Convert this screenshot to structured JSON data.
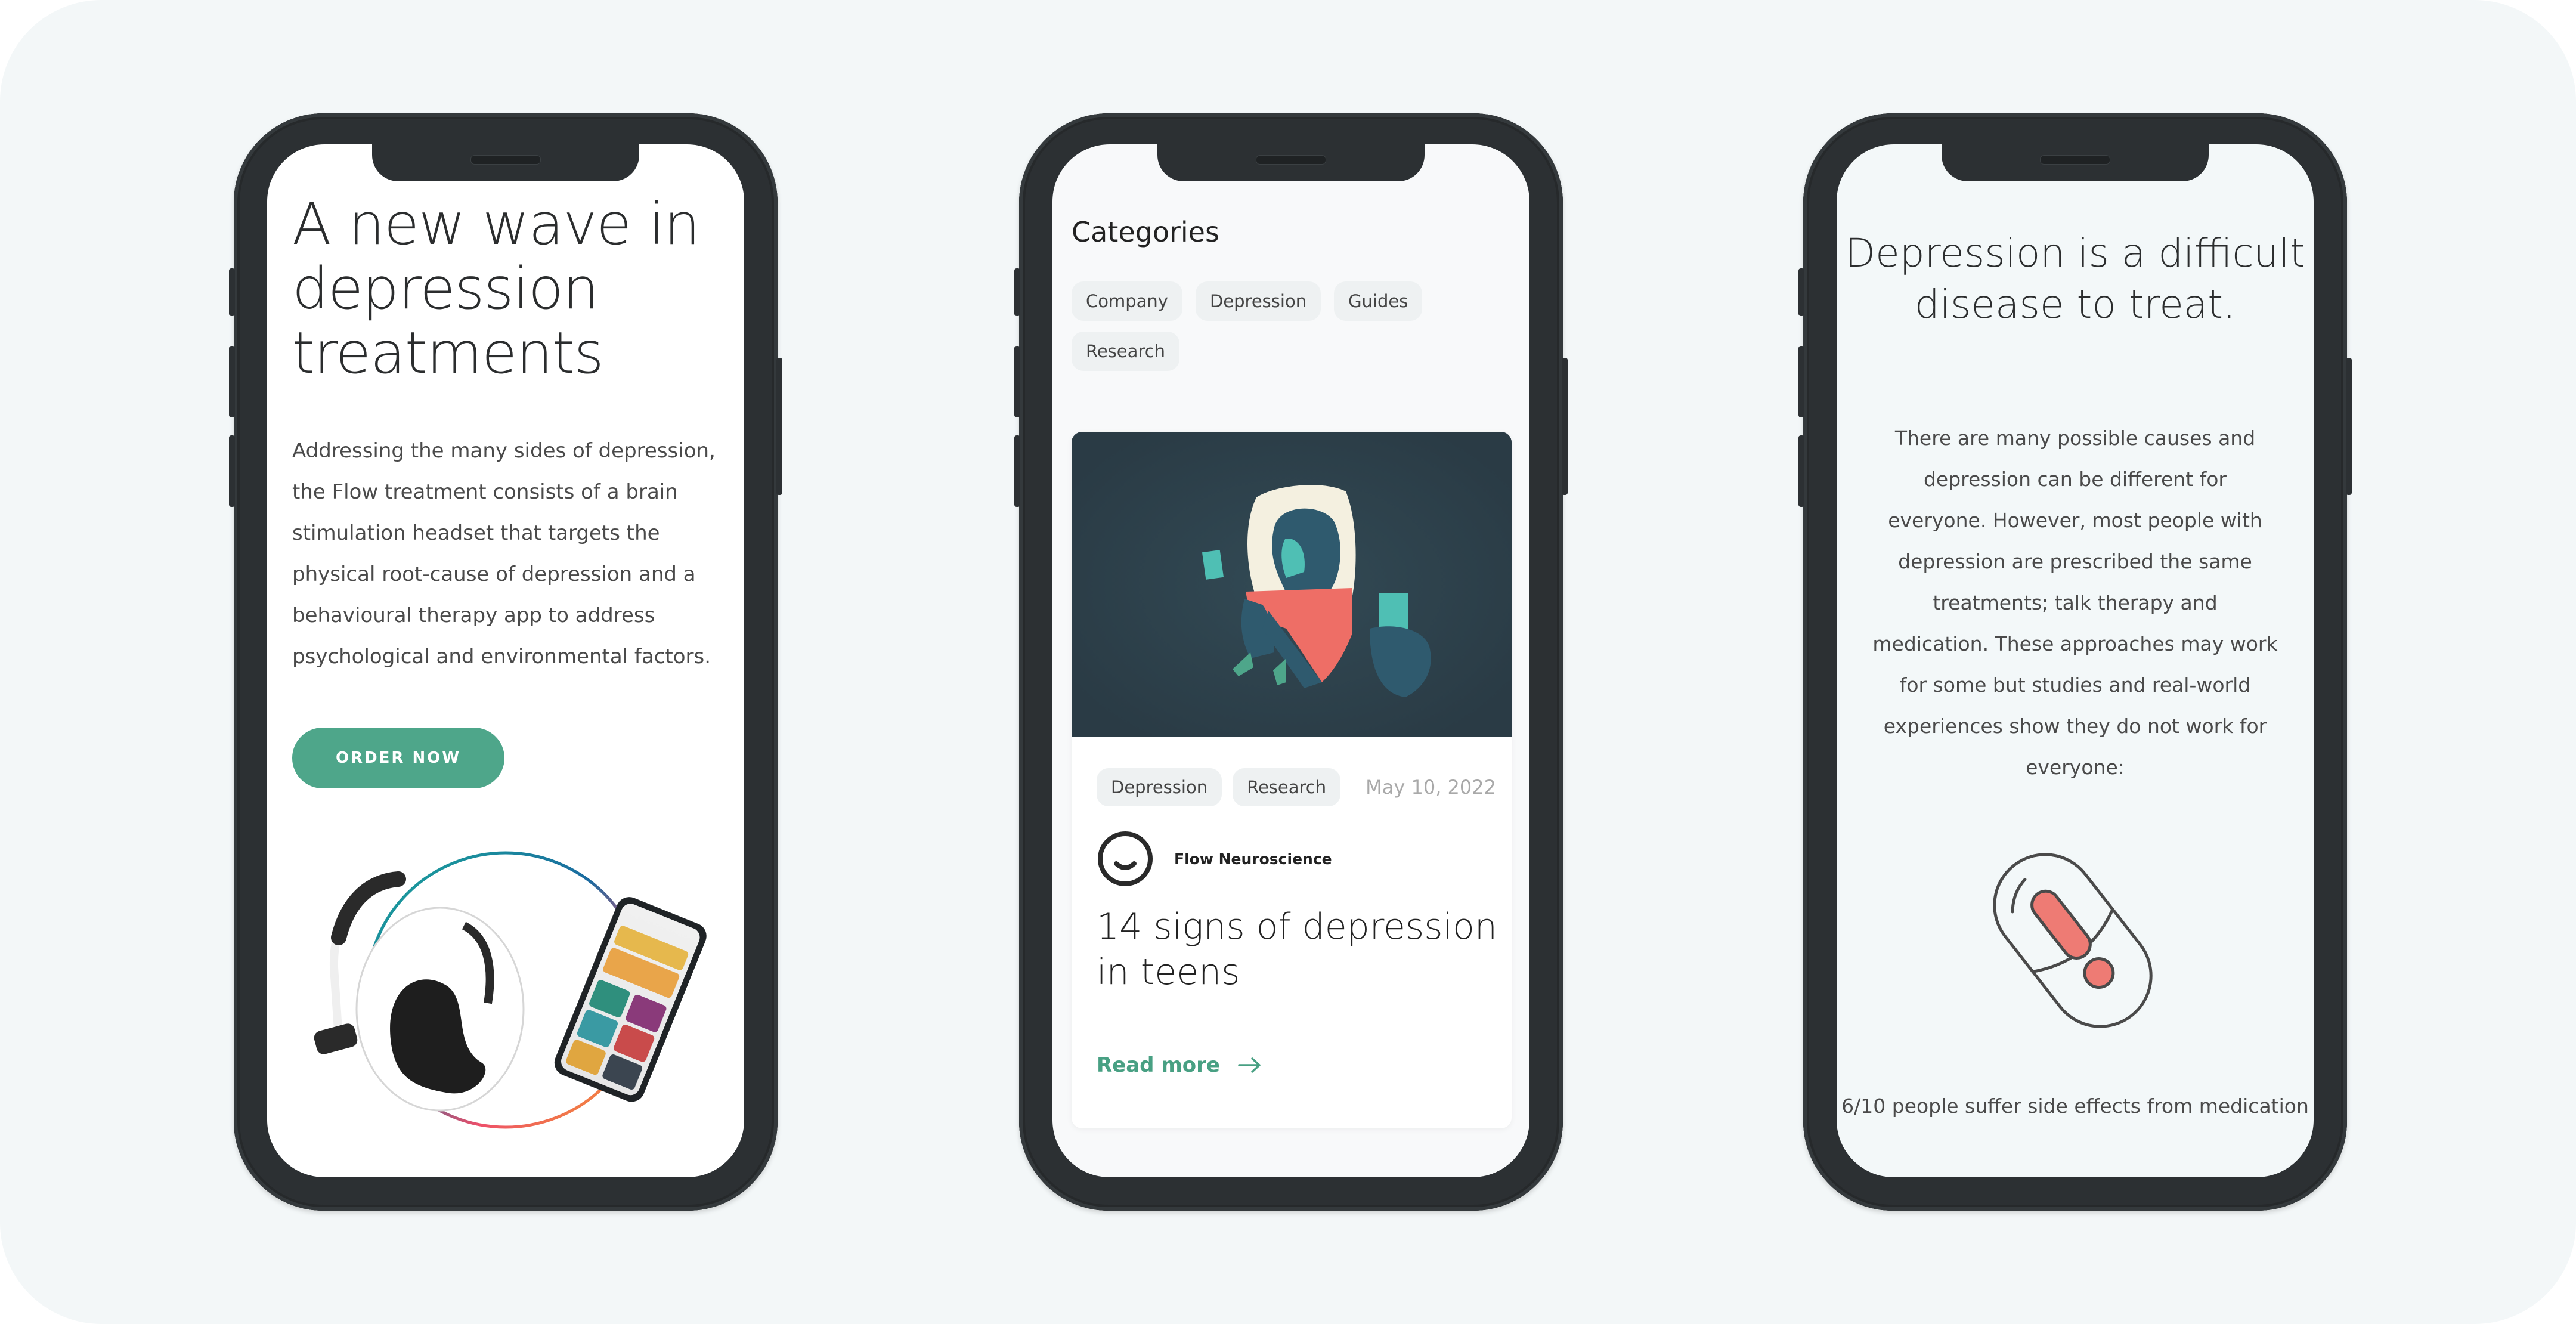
{
  "colors": {
    "background": "#f3f7f8",
    "phone_frame": "#2c3033",
    "accent_green": "#4ea68a",
    "link_green": "#48a083",
    "coral": "#ee7b74",
    "chip_bg": "#eef1f2"
  },
  "phone1": {
    "hero_title": "A new wave in depression treatments",
    "hero_body": "Addressing the many sides of depression, the Flow treatment consists of a brain stimulation headset that targets the physical root-cause of depression and a behavioural therapy app to address psychological and environmental factors.",
    "order_button": "ORDER NOW",
    "product_image": "headset-and-phone-app-image"
  },
  "phone2": {
    "categories_title": "Categories",
    "categories": [
      "Company",
      "Depression",
      "Guides",
      "Research"
    ],
    "article": {
      "image": "person-hugging-knees-illustration",
      "tags": [
        "Depression",
        "Research"
      ],
      "date": "May 10, 2022",
      "author": "Flow Neuroscience",
      "author_logo": "smile-logo-icon",
      "title": "14 signs of depression in teens",
      "read_more": "Read more",
      "read_more_icon": "arrow-right-icon"
    }
  },
  "phone3": {
    "title": "Depression is a difficult disease to treat.",
    "body": "There are many possible causes and depression can be different for everyone. However, most people with depression are prescribed the same treatments; talk therapy and medication. These approaches may work for some but studies and real-world experiences show they do not work for everyone:",
    "icon": "pill-warning-icon",
    "stat": "6/10 people suffer side effects from medication"
  }
}
